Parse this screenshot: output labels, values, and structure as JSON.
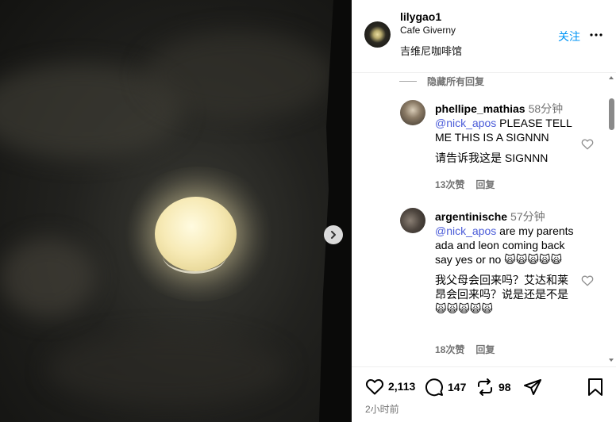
{
  "post": {
    "username": "lilygao1",
    "location": "Cafe Giverny",
    "caption": "吉维尼咖啡馆",
    "follow_label": "关注",
    "time_ago": "2小时前"
  },
  "comments_section": {
    "hide_replies_label": "隐藏所有回复",
    "items": [
      {
        "user": "phellipe_mathias",
        "time": "58分钟",
        "mention": "@nick_apos",
        "text": " PLEASE TELL ME THIS IS A SIGNNN",
        "translation": "请告诉我这是 SIGNNN",
        "likes": "13次赞",
        "reply": "回复"
      },
      {
        "user": "argentinische",
        "time": "57分钟",
        "mention": "@nick_apos",
        "text": " are my parents ada and leon coming back say yes or no 🙀🙀🙀🙀🙀",
        "translation": "我父母会回来吗？艾达和莱昂会回来吗？说是还是不是🙀🙀🙀🙀🙀",
        "likes": "18次赞",
        "reply": "回复"
      }
    ]
  },
  "actions": {
    "likes": "2,113",
    "comments": "147",
    "reposts": "98"
  },
  "icons": [
    "more-icon",
    "heart-icon",
    "comment-icon",
    "repost-icon",
    "share-icon",
    "bookmark-icon",
    "chevron-right-icon"
  ],
  "colors": {
    "accent": "#0095f6",
    "mention": "#4a5bd8",
    "muted": "#737373"
  }
}
